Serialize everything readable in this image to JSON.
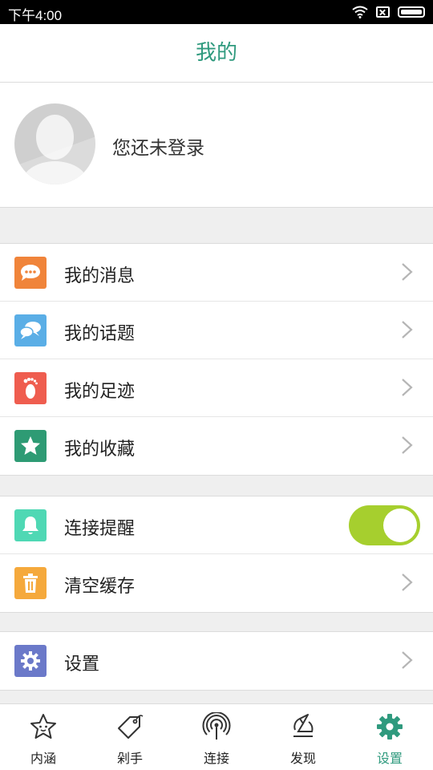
{
  "status_bar": {
    "time": "下午4:00"
  },
  "header": {
    "title": "我的"
  },
  "profile": {
    "login_text": "您还未登录"
  },
  "menu_group_1": [
    {
      "label": "我的消息",
      "icon": "chat-bubble-icon",
      "color": "#f0843a"
    },
    {
      "label": "我的话题",
      "icon": "topic-bubbles-icon",
      "color": "#5aaee6"
    },
    {
      "label": "我的足迹",
      "icon": "footprint-icon",
      "color": "#ef5d4f"
    },
    {
      "label": "我的收藏",
      "icon": "star-icon",
      "color": "#2e9b74"
    }
  ],
  "menu_group_2": [
    {
      "label": "连接提醒",
      "icon": "bell-icon",
      "color": "#4fd8b4",
      "toggle_on": true
    },
    {
      "label": "清空缓存",
      "icon": "trash-icon",
      "color": "#f5a93c"
    }
  ],
  "menu_group_3": [
    {
      "label": "设置",
      "icon": "gear-icon",
      "color": "#6b79c9"
    }
  ],
  "tabbar": [
    {
      "label": "内涵",
      "icon": "star-outline-icon",
      "active": false
    },
    {
      "label": "剁手",
      "icon": "tag-icon",
      "active": false
    },
    {
      "label": "连接",
      "icon": "signal-tower-icon",
      "active": false
    },
    {
      "label": "发现",
      "icon": "discover-icon",
      "active": false
    },
    {
      "label": "设置",
      "icon": "gear-icon",
      "active": true
    }
  ],
  "colors": {
    "accent": "#2f9a7e",
    "toggle_on": "#a6cf2e"
  }
}
